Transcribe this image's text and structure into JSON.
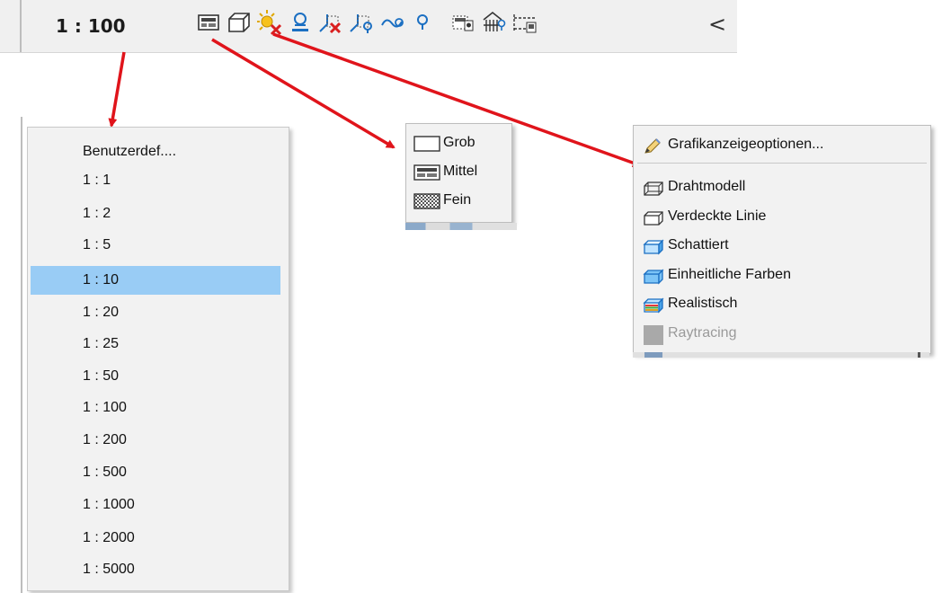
{
  "toolbar": {
    "scale": "1 : 100",
    "icons": [
      "detail-level-icon",
      "visual-style-icon",
      "sun-path-off-icon",
      "shadows-icon",
      "crop-view-off-icon",
      "show-crop-region-icon",
      "unlock-3d-view-icon",
      "temporary-hide-icon",
      "reveal-hidden-icon",
      "analytical-model-icon",
      "highlight-displacement-icon"
    ],
    "more": "<"
  },
  "scale_menu": {
    "items": [
      "Benutzerdef....",
      "1 : 1",
      "1 : 2",
      "1 : 5",
      "1 : 10",
      "1 : 20",
      "1 : 25",
      "1 : 50",
      "1 : 100",
      "1 : 200",
      "1 : 500",
      "1 : 1000",
      "1 : 2000",
      "1 : 5000"
    ],
    "selected": "1 : 10"
  },
  "detail_menu": {
    "items": [
      {
        "label": "Grob",
        "icon": "coarse-icon"
      },
      {
        "label": "Mittel",
        "icon": "medium-icon"
      },
      {
        "label": "Fein",
        "icon": "fine-icon"
      }
    ]
  },
  "style_menu": {
    "header": {
      "label": "Grafikanzeigeoptionen...",
      "icon": "graphic-display-options-icon"
    },
    "items": [
      {
        "label": "Drahtmodell",
        "icon": "wireframe-icon"
      },
      {
        "label": "Verdeckte Linie",
        "icon": "hidden-line-icon"
      },
      {
        "label": "Schattiert",
        "icon": "shaded-icon"
      },
      {
        "label": "Einheitliche Farben",
        "icon": "consistent-colors-icon"
      },
      {
        "label": "Realistisch",
        "icon": "realistic-icon"
      },
      {
        "label": "Raytracing",
        "icon": "raytracing-icon",
        "disabled": true
      }
    ]
  },
  "colors": {
    "selection": "#99ccf5",
    "arrow": "#e0141b",
    "menu_bg": "#f2f2f2",
    "toolbar_bg": "#f0f0f0",
    "disabled_text": "#9a9a9a"
  }
}
